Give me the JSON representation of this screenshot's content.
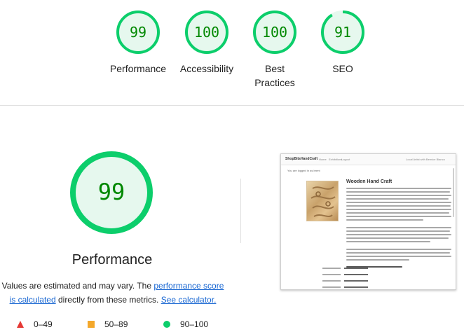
{
  "categories": [
    {
      "score": 99,
      "label": "Performance"
    },
    {
      "score": 100,
      "label": "Accessibility"
    },
    {
      "score": 100,
      "label": "Best Practices"
    },
    {
      "score": 91,
      "label": "SEO"
    }
  ],
  "performance": {
    "score": 99,
    "title": "Performance",
    "note_prefix": "Values are estimated and may vary. The ",
    "note_link1": "performance score is calculated",
    "note_mid": " directly from these metrics. ",
    "note_link2": "See calculator."
  },
  "legend": [
    {
      "range": "0–49",
      "color": "#e53935",
      "shape": "triangle"
    },
    {
      "range": "50–89",
      "color": "#f4a82b",
      "shape": "square"
    },
    {
      "range": "90–100",
      "color": "#0cce6b",
      "shape": "circle"
    }
  ],
  "colors": {
    "pass_ring": "#0cce6b",
    "pass_fill": "#e6f8ee",
    "pass_text": "#008800"
  },
  "screenshot": {
    "brand": "ShopBitsHandCraft",
    "nav_links": [
      "Home",
      "Exhibitions",
      "Logout"
    ],
    "nav_right": "Local Artist with Bernice Bianco",
    "login_note": "You are logged in as brent",
    "heading": "Wooden Hand Craft"
  }
}
